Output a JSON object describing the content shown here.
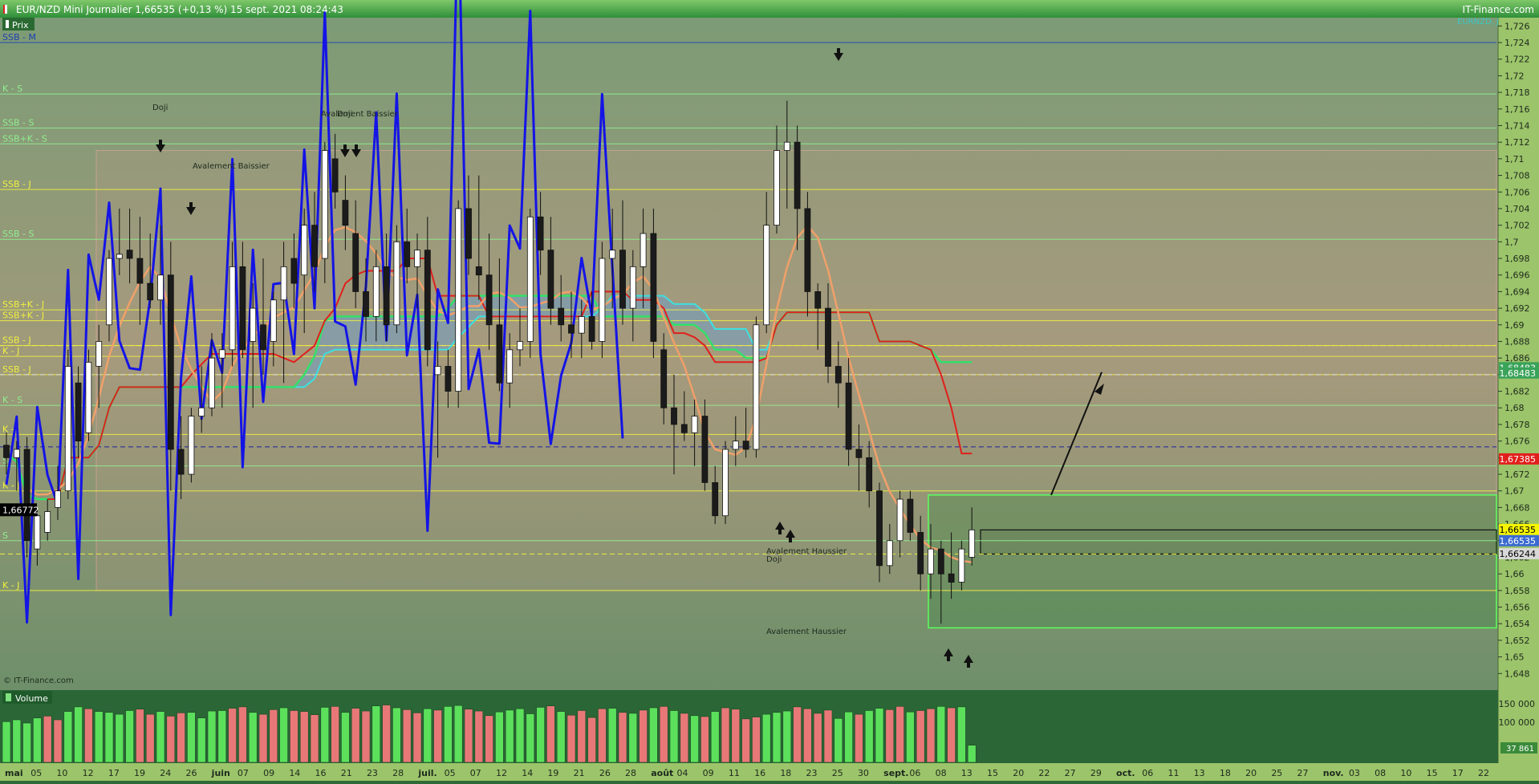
{
  "header": {
    "title": "EUR/NZD Mini Journalier 1,66535 (+0,13 %) 15 sept. 2021 08:24:43",
    "brand": "IT-Finance.com",
    "symbol_tag": "EURNZD, J"
  },
  "panels": {
    "price_label": "Prix",
    "volume_label": "Volume",
    "copyright": "© IT-Finance.com"
  },
  "colors": {
    "price_bg_top": "#7c9b76",
    "price_bg_mid": "#9f9a7a",
    "price_bg_bottom": "#6f906b",
    "volume_bg": "#2a6636",
    "axis_bg": "#96c15f",
    "bull_candle": "#ffffff",
    "bear_candle": "#1b1b1b",
    "blue_line": "#1414e6",
    "orange_line": "#f0a06a",
    "red_line": "#e0201c",
    "green_line": "#33e06a",
    "cyan_line": "#3ee0e0",
    "cloud": "#6f9fc4",
    "level_yellow": "#f0f040",
    "level_green": "#90ee90",
    "volume_up": "#5ce05c",
    "volume_down": "#e87878"
  },
  "chart_data": {
    "type": "candlestick",
    "title": "EUR/NZD Mini Journalier 1,66535 (+0,13 %) 15 sept. 2021 08:24:43",
    "y_axis": {
      "min": 1.646,
      "max": 1.727,
      "ticks": [
        "1,726",
        "1,724",
        "1,722",
        "1,72",
        "1,718",
        "1,716",
        "1,714",
        "1,712",
        "1,71",
        "1,708",
        "1,706",
        "1,704",
        "1,702",
        "1,7",
        "1,698",
        "1,696",
        "1,694",
        "1,692",
        "1,69",
        "1,688",
        "1,686",
        "1,684",
        "1,682",
        "1,68",
        "1,678",
        "1,676",
        "1,674",
        "1,672",
        "1,67",
        "1,668",
        "1,666",
        "1,664",
        "1,662",
        "1,66",
        "1,658",
        "1,656",
        "1,654",
        "1,652",
        "1,65",
        "1,648"
      ],
      "tick_values": [
        1.726,
        1.724,
        1.722,
        1.72,
        1.718,
        1.716,
        1.714,
        1.712,
        1.71,
        1.708,
        1.706,
        1.704,
        1.702,
        1.7,
        1.698,
        1.696,
        1.694,
        1.692,
        1.69,
        1.688,
        1.686,
        1.684,
        1.682,
        1.68,
        1.678,
        1.676,
        1.674,
        1.672,
        1.67,
        1.668,
        1.666,
        1.664,
        1.662,
        1.66,
        1.658,
        1.656,
        1.654,
        1.652,
        1.65,
        1.648
      ]
    },
    "x_axis": {
      "labels": [
        "mai",
        "05",
        "10",
        "12",
        "17",
        "19",
        "24",
        "26",
        "juin",
        "07",
        "09",
        "14",
        "16",
        "21",
        "23",
        "28",
        "juil.",
        "05",
        "07",
        "12",
        "14",
        "19",
        "21",
        "26",
        "28",
        "août",
        "04",
        "09",
        "11",
        "16",
        "18",
        "23",
        "25",
        "30",
        "sept.",
        "06",
        "08",
        "13",
        "15",
        "20",
        "22",
        "27",
        "29",
        "oct.",
        "06",
        "11",
        "13",
        "18",
        "20",
        "25",
        "27",
        "nov.",
        "03",
        "08",
        "10",
        "15",
        "17",
        "22"
      ]
    },
    "candles": [
      {
        "o": 1.6755,
        "h": 1.677,
        "l": 1.672,
        "c": 1.674
      },
      {
        "o": 1.674,
        "h": 1.676,
        "l": 1.67,
        "c": 1.675
      },
      {
        "o": 1.675,
        "h": 1.6765,
        "l": 1.662,
        "c": 1.664
      },
      {
        "o": 1.663,
        "h": 1.668,
        "l": 1.661,
        "c": 1.667
      },
      {
        "o": 1.665,
        "h": 1.669,
        "l": 1.664,
        "c": 1.6675
      },
      {
        "o": 1.668,
        "h": 1.673,
        "l": 1.6665,
        "c": 1.67
      },
      {
        "o": 1.67,
        "h": 1.687,
        "l": 1.669,
        "c": 1.685
      },
      {
        "o": 1.683,
        "h": 1.685,
        "l": 1.674,
        "c": 1.676
      },
      {
        "o": 1.677,
        "h": 1.687,
        "l": 1.676,
        "c": 1.6855
      },
      {
        "o": 1.685,
        "h": 1.69,
        "l": 1.68,
        "c": 1.688
      },
      {
        "o": 1.69,
        "h": 1.699,
        "l": 1.688,
        "c": 1.698
      },
      {
        "o": 1.698,
        "h": 1.704,
        "l": 1.696,
        "c": 1.6985
      },
      {
        "o": 1.699,
        "h": 1.704,
        "l": 1.695,
        "c": 1.698
      },
      {
        "o": 1.698,
        "h": 1.703,
        "l": 1.69,
        "c": 1.695
      },
      {
        "o": 1.695,
        "h": 1.701,
        "l": 1.692,
        "c": 1.693
      },
      {
        "o": 1.693,
        "h": 1.702,
        "l": 1.69,
        "c": 1.696
      },
      {
        "o": 1.696,
        "h": 1.7,
        "l": 1.67,
        "c": 1.675
      },
      {
        "o": 1.675,
        "h": 1.679,
        "l": 1.669,
        "c": 1.672
      },
      {
        "o": 1.672,
        "h": 1.68,
        "l": 1.671,
        "c": 1.679
      },
      {
        "o": 1.679,
        "h": 1.685,
        "l": 1.677,
        "c": 1.68
      },
      {
        "o": 1.68,
        "h": 1.689,
        "l": 1.679,
        "c": 1.686
      },
      {
        "o": 1.686,
        "h": 1.689,
        "l": 1.68,
        "c": 1.687
      },
      {
        "o": 1.687,
        "h": 1.7,
        "l": 1.685,
        "c": 1.697
      },
      {
        "o": 1.697,
        "h": 1.7,
        "l": 1.686,
        "c": 1.687
      },
      {
        "o": 1.688,
        "h": 1.695,
        "l": 1.68,
        "c": 1.692
      },
      {
        "o": 1.69,
        "h": 1.698,
        "l": 1.684,
        "c": 1.687
      },
      {
        "o": 1.688,
        "h": 1.694,
        "l": 1.685,
        "c": 1.693
      },
      {
        "o": 1.693,
        "h": 1.7,
        "l": 1.683,
        "c": 1.697
      },
      {
        "o": 1.698,
        "h": 1.701,
        "l": 1.692,
        "c": 1.695
      },
      {
        "o": 1.696,
        "h": 1.704,
        "l": 1.689,
        "c": 1.702
      },
      {
        "o": 1.702,
        "h": 1.706,
        "l": 1.694,
        "c": 1.697
      },
      {
        "o": 1.698,
        "h": 1.712,
        "l": 1.695,
        "c": 1.711
      },
      {
        "o": 1.71,
        "h": 1.713,
        "l": 1.704,
        "c": 1.706
      },
      {
        "o": 1.705,
        "h": 1.708,
        "l": 1.699,
        "c": 1.702
      },
      {
        "o": 1.701,
        "h": 1.705,
        "l": 1.692,
        "c": 1.694
      },
      {
        "o": 1.694,
        "h": 1.698,
        "l": 1.688,
        "c": 1.691
      },
      {
        "o": 1.691,
        "h": 1.699,
        "l": 1.688,
        "c": 1.697
      },
      {
        "o": 1.697,
        "h": 1.701,
        "l": 1.688,
        "c": 1.69
      },
      {
        "o": 1.69,
        "h": 1.702,
        "l": 1.689,
        "c": 1.7
      },
      {
        "o": 1.7,
        "h": 1.704,
        "l": 1.695,
        "c": 1.697
      },
      {
        "o": 1.697,
        "h": 1.701,
        "l": 1.692,
        "c": 1.699
      },
      {
        "o": 1.699,
        "h": 1.703,
        "l": 1.685,
        "c": 1.687
      },
      {
        "o": 1.684,
        "h": 1.688,
        "l": 1.674,
        "c": 1.685
      },
      {
        "o": 1.685,
        "h": 1.687,
        "l": 1.68,
        "c": 1.682
      },
      {
        "o": 1.682,
        "h": 1.705,
        "l": 1.68,
        "c": 1.704
      },
      {
        "o": 1.704,
        "h": 1.708,
        "l": 1.696,
        "c": 1.698
      },
      {
        "o": 1.697,
        "h": 1.708,
        "l": 1.693,
        "c": 1.696
      },
      {
        "o": 1.696,
        "h": 1.701,
        "l": 1.687,
        "c": 1.69
      },
      {
        "o": 1.69,
        "h": 1.698,
        "l": 1.682,
        "c": 1.683
      },
      {
        "o": 1.683,
        "h": 1.689,
        "l": 1.68,
        "c": 1.687
      },
      {
        "o": 1.687,
        "h": 1.692,
        "l": 1.685,
        "c": 1.688
      },
      {
        "o": 1.688,
        "h": 1.704,
        "l": 1.686,
        "c": 1.703
      },
      {
        "o": 1.703,
        "h": 1.706,
        "l": 1.696,
        "c": 1.699
      },
      {
        "o": 1.699,
        "h": 1.703,
        "l": 1.69,
        "c": 1.692
      },
      {
        "o": 1.692,
        "h": 1.696,
        "l": 1.688,
        "c": 1.69
      },
      {
        "o": 1.69,
        "h": 1.694,
        "l": 1.686,
        "c": 1.689
      },
      {
        "o": 1.689,
        "h": 1.693,
        "l": 1.686,
        "c": 1.691
      },
      {
        "o": 1.691,
        "h": 1.694,
        "l": 1.687,
        "c": 1.688
      },
      {
        "o": 1.688,
        "h": 1.7,
        "l": 1.686,
        "c": 1.698
      },
      {
        "o": 1.698,
        "h": 1.704,
        "l": 1.692,
        "c": 1.699
      },
      {
        "o": 1.699,
        "h": 1.705,
        "l": 1.69,
        "c": 1.692
      },
      {
        "o": 1.692,
        "h": 1.699,
        "l": 1.688,
        "c": 1.697
      },
      {
        "o": 1.697,
        "h": 1.704,
        "l": 1.692,
        "c": 1.701
      },
      {
        "o": 1.701,
        "h": 1.704,
        "l": 1.686,
        "c": 1.688
      },
      {
        "o": 1.687,
        "h": 1.689,
        "l": 1.678,
        "c": 1.68
      },
      {
        "o": 1.68,
        "h": 1.684,
        "l": 1.672,
        "c": 1.678
      },
      {
        "o": 1.678,
        "h": 1.682,
        "l": 1.676,
        "c": 1.677
      },
      {
        "o": 1.677,
        "h": 1.681,
        "l": 1.673,
        "c": 1.679
      },
      {
        "o": 1.679,
        "h": 1.681,
        "l": 1.67,
        "c": 1.671
      },
      {
        "o": 1.671,
        "h": 1.673,
        "l": 1.666,
        "c": 1.667
      },
      {
        "o": 1.667,
        "h": 1.676,
        "l": 1.666,
        "c": 1.675
      },
      {
        "o": 1.675,
        "h": 1.679,
        "l": 1.673,
        "c": 1.676
      },
      {
        "o": 1.676,
        "h": 1.68,
        "l": 1.674,
        "c": 1.675
      },
      {
        "o": 1.675,
        "h": 1.691,
        "l": 1.674,
        "c": 1.69
      },
      {
        "o": 1.69,
        "h": 1.706,
        "l": 1.689,
        "c": 1.702
      },
      {
        "o": 1.702,
        "h": 1.714,
        "l": 1.701,
        "c": 1.711
      },
      {
        "o": 1.711,
        "h": 1.717,
        "l": 1.704,
        "c": 1.712
      },
      {
        "o": 1.712,
        "h": 1.714,
        "l": 1.699,
        "c": 1.704
      },
      {
        "o": 1.704,
        "h": 1.706,
        "l": 1.691,
        "c": 1.694
      },
      {
        "o": 1.694,
        "h": 1.695,
        "l": 1.687,
        "c": 1.692
      },
      {
        "o": 1.692,
        "h": 1.695,
        "l": 1.683,
        "c": 1.685
      },
      {
        "o": 1.685,
        "h": 1.688,
        "l": 1.68,
        "c": 1.683
      },
      {
        "o": 1.683,
        "h": 1.686,
        "l": 1.673,
        "c": 1.675
      },
      {
        "o": 1.675,
        "h": 1.678,
        "l": 1.67,
        "c": 1.674
      },
      {
        "o": 1.674,
        "h": 1.676,
        "l": 1.668,
        "c": 1.67
      },
      {
        "o": 1.67,
        "h": 1.671,
        "l": 1.659,
        "c": 1.661
      },
      {
        "o": 1.661,
        "h": 1.666,
        "l": 1.66,
        "c": 1.664
      },
      {
        "o": 1.664,
        "h": 1.67,
        "l": 1.662,
        "c": 1.669
      },
      {
        "o": 1.669,
        "h": 1.67,
        "l": 1.664,
        "c": 1.665
      },
      {
        "o": 1.665,
        "h": 1.667,
        "l": 1.658,
        "c": 1.66
      },
      {
        "o": 1.66,
        "h": 1.666,
        "l": 1.657,
        "c": 1.663
      },
      {
        "o": 1.663,
        "h": 1.664,
        "l": 1.654,
        "c": 1.66
      },
      {
        "o": 1.66,
        "h": 1.665,
        "l": 1.657,
        "c": 1.659
      },
      {
        "o": 1.659,
        "h": 1.664,
        "l": 1.658,
        "c": 1.663
      },
      {
        "o": 1.662,
        "h": 1.668,
        "l": 1.661,
        "c": 1.6653
      }
    ],
    "volume": {
      "axis_ticks": [
        "150 000",
        "100 000"
      ],
      "last_value": "37 861",
      "bars": [
        88,
        92,
        85,
        96,
        100,
        92,
        110,
        120,
        116,
        110,
        108,
        104,
        112,
        115,
        104,
        110,
        100,
        107,
        108,
        96,
        111,
        112,
        117,
        120,
        108,
        104,
        114,
        118,
        112,
        110,
        103,
        119,
        121,
        108,
        117,
        111,
        122,
        124,
        118,
        114,
        107,
        116,
        113,
        121,
        123,
        115,
        111,
        101,
        109,
        113,
        116,
        105,
        119,
        122,
        110,
        102,
        112,
        97,
        116,
        117,
        108,
        106,
        113,
        118,
        121,
        112,
        106,
        101,
        99,
        110,
        118,
        115,
        94,
        98,
        104,
        108,
        111,
        120,
        116,
        106,
        113,
        95,
        109,
        104,
        112,
        117,
        114,
        121,
        109,
        112,
        116,
        121,
        118,
        120,
        37
      ],
      "up": [
        true,
        true,
        true,
        true,
        false,
        false,
        true,
        true,
        false,
        true,
        true,
        true,
        true,
        false,
        false,
        true,
        false,
        false,
        true,
        true,
        true,
        true,
        false,
        false,
        true,
        false,
        false,
        true,
        false,
        false,
        false,
        true,
        false,
        true,
        false,
        false,
        true,
        false,
        true,
        false,
        false,
        true,
        false,
        true,
        true,
        false,
        false,
        false,
        true,
        true,
        true,
        true,
        true,
        false,
        true,
        false,
        false,
        false,
        false,
        true,
        false,
        true,
        false,
        true,
        false,
        true,
        false,
        true,
        false,
        true,
        false,
        false,
        false,
        false,
        true,
        true,
        true,
        false,
        false,
        false,
        false,
        true,
        true,
        false,
        true,
        true,
        false,
        false,
        true,
        false,
        false,
        true,
        false,
        true,
        true
      ]
    },
    "price_tags": [
      {
        "label": "1,66772",
        "value": 1.66772,
        "color": "#000000",
        "text": "#ffffff",
        "side": "left"
      },
      {
        "label": "1,68483",
        "value": 1.68483,
        "color": "#3aa35a",
        "text": "#ffffff",
        "side": "right"
      },
      {
        "label": "1,68483",
        "value": 1.6842,
        "color": "#3aa35a",
        "text": "#ffffff",
        "side": "right"
      },
      {
        "label": "1,67385",
        "value": 1.67385,
        "color": "#e0201c",
        "text": "#ffffff",
        "side": "right"
      },
      {
        "label": "1,66535",
        "value": 1.66535,
        "color": "#f5f500",
        "text": "#000000",
        "side": "right"
      },
      {
        "label": "1,66535",
        "value": 1.664,
        "color": "#3a6ad0",
        "text": "#ffffff",
        "side": "right"
      },
      {
        "label": "1,66244",
        "value": 1.66244,
        "color": "#d8d8d8",
        "text": "#000000",
        "side": "right"
      }
    ],
    "levels": [
      {
        "label": "SSB - M",
        "value": 1.724,
        "color": "#2040b0"
      },
      {
        "label": "K - S",
        "value": 1.7178,
        "color": "#90ee90"
      },
      {
        "label": "SSB - S",
        "value": 1.7137,
        "color": "#90ee90"
      },
      {
        "label": "SSB+K - S",
        "value": 1.7118,
        "color": "#90ee90"
      },
      {
        "label": "SSB - J",
        "value": 1.7063,
        "color": "#f0f040"
      },
      {
        "label": "SSB - S",
        "value": 1.7003,
        "color": "#90ee90"
      },
      {
        "label": "SSB+K - J",
        "value": 1.6918,
        "color": "#f0f040"
      },
      {
        "label": "SSB+K - J",
        "value": 1.6905,
        "color": "#f0f040"
      },
      {
        "label": "SSB - J",
        "value": 1.6875,
        "color": "#f0f040"
      },
      {
        "label": "K - J",
        "value": 1.6862,
        "color": "#f0f040"
      },
      {
        "label": "SSB - J",
        "value": 1.684,
        "color": "#f0f040"
      },
      {
        "label": "K - S",
        "value": 1.6803,
        "color": "#90ee90"
      },
      {
        "label": "K - J",
        "value": 1.6768,
        "color": "#f0f040"
      },
      {
        "label": "S",
        "value": 1.673,
        "color": "#90ee90"
      },
      {
        "label": "K - J",
        "value": 1.67,
        "color": "#f0f040"
      },
      {
        "label": "S",
        "value": 1.664,
        "color": "#90ee90"
      },
      {
        "label": "K - J",
        "value": 1.658,
        "color": "#f0f040"
      }
    ],
    "annotations": [
      {
        "text": "Doji"
      },
      {
        "text": "Avalement Baissier"
      },
      {
        "text": "Avalement Baissier"
      },
      {
        "text": "Doji"
      },
      {
        "text": "Avalement Haussier"
      },
      {
        "text": "Doji"
      },
      {
        "text": "Avalement Haussier"
      }
    ]
  }
}
